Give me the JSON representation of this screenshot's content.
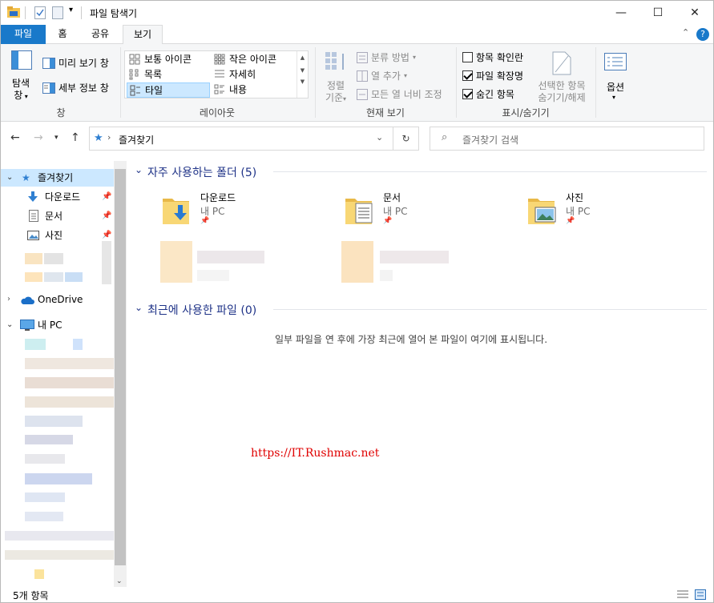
{
  "window": {
    "title": "파일 탐색기",
    "controls": {
      "minimize": "—",
      "maximize": "☐",
      "close": "✕"
    }
  },
  "ribbon_tabs": [
    "파일",
    "홈",
    "공유",
    "보기"
  ],
  "ribbon": {
    "pane": {
      "nav_pane_label": "탐색",
      "nav_pane_label2": "창",
      "preview_pane": "미리 보기 창",
      "details_pane": "세부 정보 창",
      "group_label": "창"
    },
    "layout": {
      "items": [
        "보통 아이콘",
        "작은 아이콘",
        "목록",
        "자세히",
        "타일",
        "내용"
      ],
      "selected": "타일",
      "group_label": "레이아웃"
    },
    "current_view": {
      "sort_by_1": "정렬",
      "sort_by_2": "기준",
      "group_by": "분류 방법",
      "add_columns": "열 추가",
      "size_all_columns": "모든 열 너비 조정",
      "group_label": "현재 보기"
    },
    "show_hide": {
      "item_check_boxes": "항목 확인란",
      "item_check_boxes_checked": false,
      "file_name_extensions": "파일 확장명",
      "file_name_extensions_checked": true,
      "hidden_items": "숨긴 항목",
      "hidden_items_checked": true,
      "hide_selected_1": "선택한 항목",
      "hide_selected_2": "숨기기/해제",
      "group_label": "표시/숨기기"
    },
    "options": {
      "label": "옵션"
    }
  },
  "address": {
    "path": "즐겨찾기",
    "search_placeholder": "즐겨찾기 검색"
  },
  "nav_pane": {
    "quick_access": "즐겨찾기",
    "pinned": [
      "다운로드",
      "문서",
      "사진"
    ],
    "onedrive": "OneDrive",
    "this_pc": "내 PC"
  },
  "content": {
    "frequent_header": "자주 사용하는 폴더 (5)",
    "folders": [
      {
        "name": "다운로드",
        "location": "내 PC"
      },
      {
        "name": "문서",
        "location": "내 PC"
      },
      {
        "name": "사진",
        "location": "내 PC"
      }
    ],
    "recent_header": "최근에 사용한 파일 (0)",
    "recent_empty": "일부 파일을 연 후에 가장 최근에 열어 본 파일이 여기에 표시됩니다."
  },
  "watermark": "https://IT.Rushmac.net",
  "status": {
    "items": "5개 항목"
  },
  "colors": {
    "accent": "#1979ca",
    "selected": "#cce8ff",
    "section_header": "#1e3287",
    "folder": "#f8d775",
    "watermark": "#e00000"
  }
}
